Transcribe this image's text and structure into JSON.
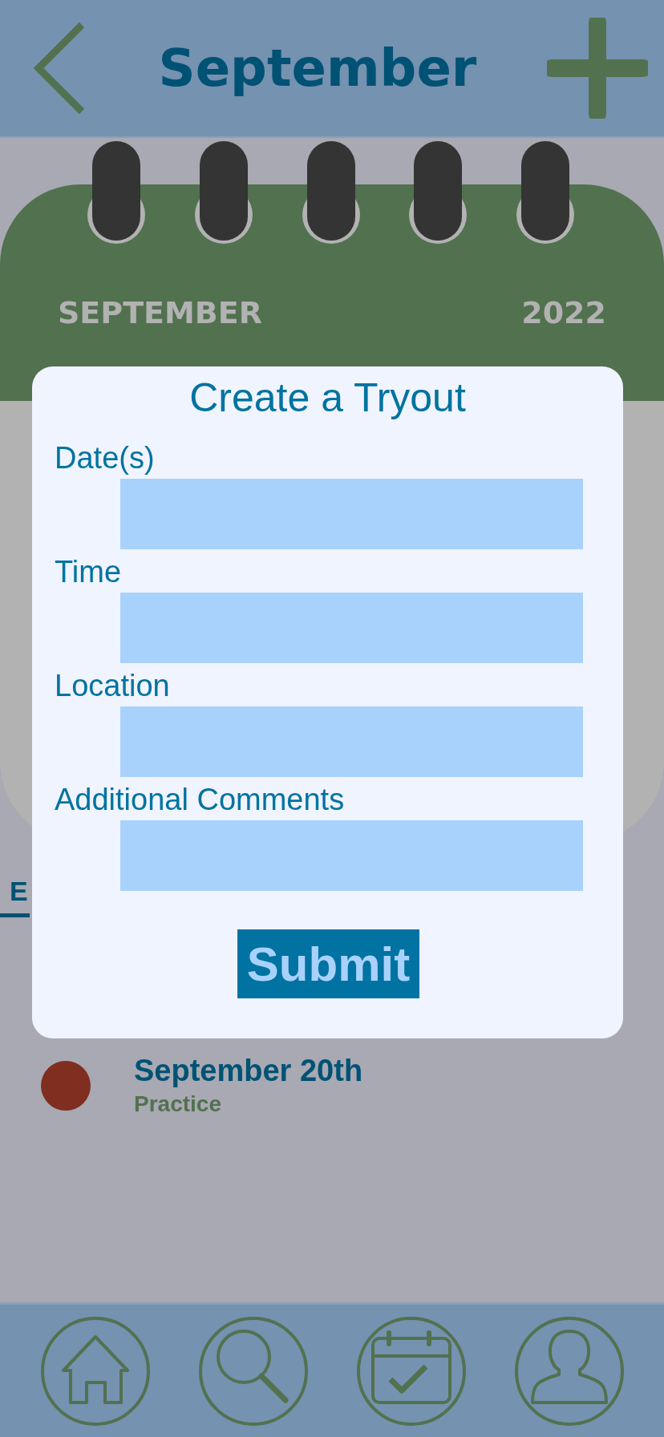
{
  "header": {
    "title": "September"
  },
  "calendar": {
    "month": "SEPTEMBER",
    "year": "2022"
  },
  "tabs": [
    {
      "label": "E",
      "selected": true
    }
  ],
  "events": [
    {
      "date": "September 20th",
      "type": "Practice",
      "color": "#7f2e20"
    }
  ],
  "dialog": {
    "title": "Create a Tryout",
    "fields": [
      {
        "label": "Date(s)"
      },
      {
        "label": "Time"
      },
      {
        "label": "Location"
      },
      {
        "label": "Additional Comments"
      }
    ],
    "submit": "Submit"
  },
  "nav": [
    {
      "kind": "home"
    },
    {
      "kind": "search"
    },
    {
      "kind": "calendar"
    },
    {
      "kind": "profile"
    }
  ]
}
